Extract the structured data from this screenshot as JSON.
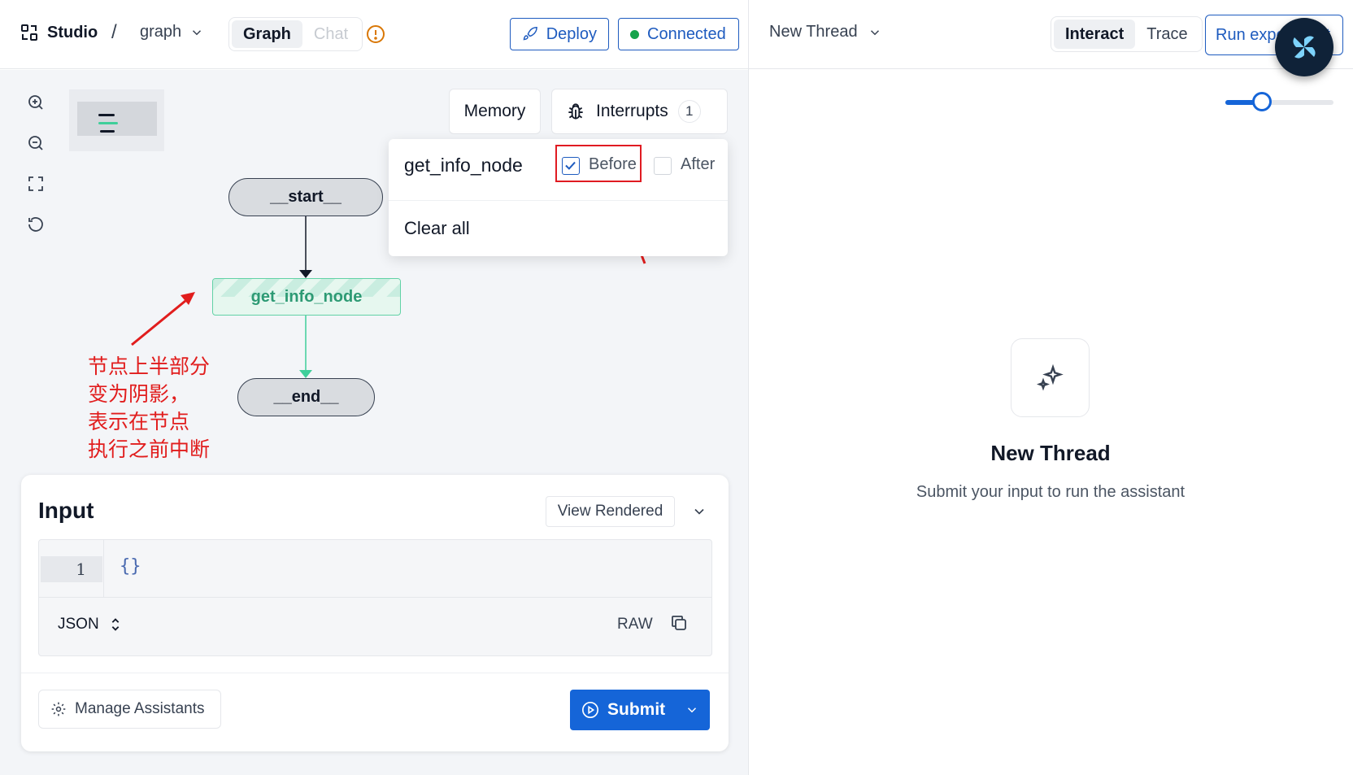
{
  "header": {
    "brand": "Studio",
    "separator": "/",
    "graph_name": "graph",
    "mode_tabs": [
      "Graph",
      "Chat"
    ],
    "deploy_label": "Deploy",
    "connection_status": "Connected",
    "thread_name": "New Thread",
    "view_tabs": [
      "Interact",
      "Trace"
    ],
    "run_experiment_label": "Run experiment"
  },
  "canvas": {
    "memory_label": "Memory",
    "interrupts_label": "Interrupts",
    "interrupts_count": "1",
    "nodes": {
      "start": "__start__",
      "info": "get_info_node",
      "end": "__end__"
    },
    "annotation_lines": [
      "节点上半部分",
      "变为阴影，",
      "表示在节点",
      "执行之前中断"
    ]
  },
  "interrupt_popover": {
    "node_name": "get_info_node",
    "before_label": "Before",
    "before_checked": true,
    "after_label": "After",
    "after_checked": false,
    "clear_all_label": "Clear all"
  },
  "input_panel": {
    "title": "Input",
    "view_mode": "View Rendered",
    "line_number": "1",
    "code": "{}",
    "format": "JSON",
    "raw_label": "RAW",
    "manage_assistants_label": "Manage Assistants",
    "submit_label": "Submit"
  },
  "thread_panel": {
    "slider_level": 0.34,
    "empty_title": "New Thread",
    "empty_subtitle": "Submit your input to run the assistant"
  },
  "colors": {
    "accent": "#1e5bbf",
    "submit": "#1565d8",
    "connected_dot": "#15a34a",
    "node_green": "#2d9a74",
    "annotation_red": "#e11d1d"
  }
}
